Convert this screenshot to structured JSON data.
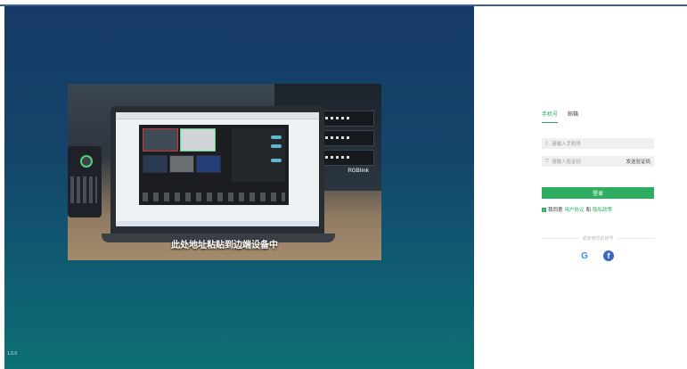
{
  "version": "1.0.0",
  "promo": {
    "caption": "此处地址粘贴到边端设备中",
    "rack_brand": "RGBlink"
  },
  "login": {
    "tabs": [
      {
        "label": "手机号",
        "active": true
      },
      {
        "label": "邮箱",
        "active": false
      }
    ],
    "phone_placeholder": "请输入手机号",
    "code_placeholder": "请输入验证码",
    "send_code": "发送验证码",
    "submit": "登录",
    "agree_prefix": "我同意",
    "user_agreement": "用户协议",
    "and": "和",
    "privacy_policy": "隐私政策",
    "other_login": "或使用您的账号",
    "accent_color": "#2fad63"
  },
  "icons": [
    "phone-icon",
    "shield-icon",
    "google-icon",
    "facebook-icon",
    "checkbox-icon"
  ]
}
